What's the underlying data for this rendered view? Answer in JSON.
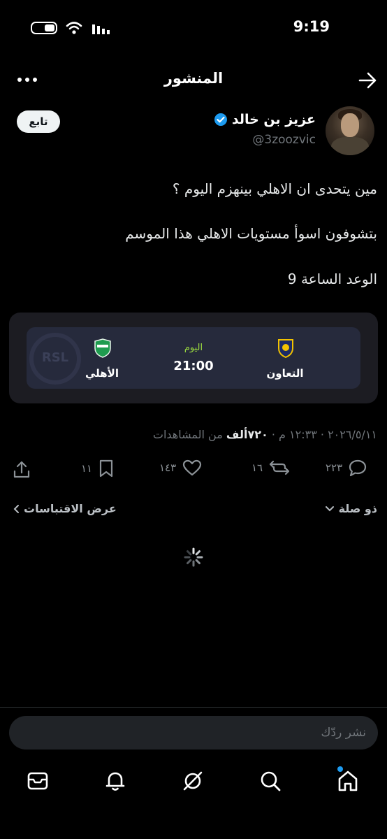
{
  "status_bar": {
    "time": "9:19"
  },
  "header": {
    "title": "المنشور"
  },
  "author": {
    "name": "عزيز بن خالد",
    "handle": "@3zoozvic",
    "verified": true,
    "follow_label": "تابع"
  },
  "tweet": {
    "lines": [
      "مين يتحدى ان الاهلي بينهزم اليوم ؟",
      "بتشوفون اسوأ مستويات الاهلي هذا الموسم",
      "الوعد الساعة 9"
    ]
  },
  "match_card": {
    "league_logo_text": "RSL",
    "home_team": "التعاون",
    "away_team": "الأهلي",
    "day": "اليوم",
    "time": "21:00",
    "home_color": "#f2c200",
    "away_color": "#1f9c4f"
  },
  "meta": {
    "time": "١٢:٣٣ م",
    "date": "٢٠٢٦/٥/١١",
    "views": "٧٢٠ألف",
    "views_suffix": "من المشاهدات",
    "separator": "·"
  },
  "actions": {
    "replies": "٢٢٣",
    "retweets": "١٦",
    "likes": "١٤٣",
    "bookmarks": "١١"
  },
  "links": {
    "relevant": "ذو صلة",
    "quotes": "عرض الاقتباسات"
  },
  "reply": {
    "placeholder": "نشر ردّك"
  },
  "nav": {
    "items": [
      "home-icon",
      "search-icon",
      "grok-icon",
      "notifications-icon",
      "messages-icon"
    ],
    "accent": "#1d9bf0"
  }
}
